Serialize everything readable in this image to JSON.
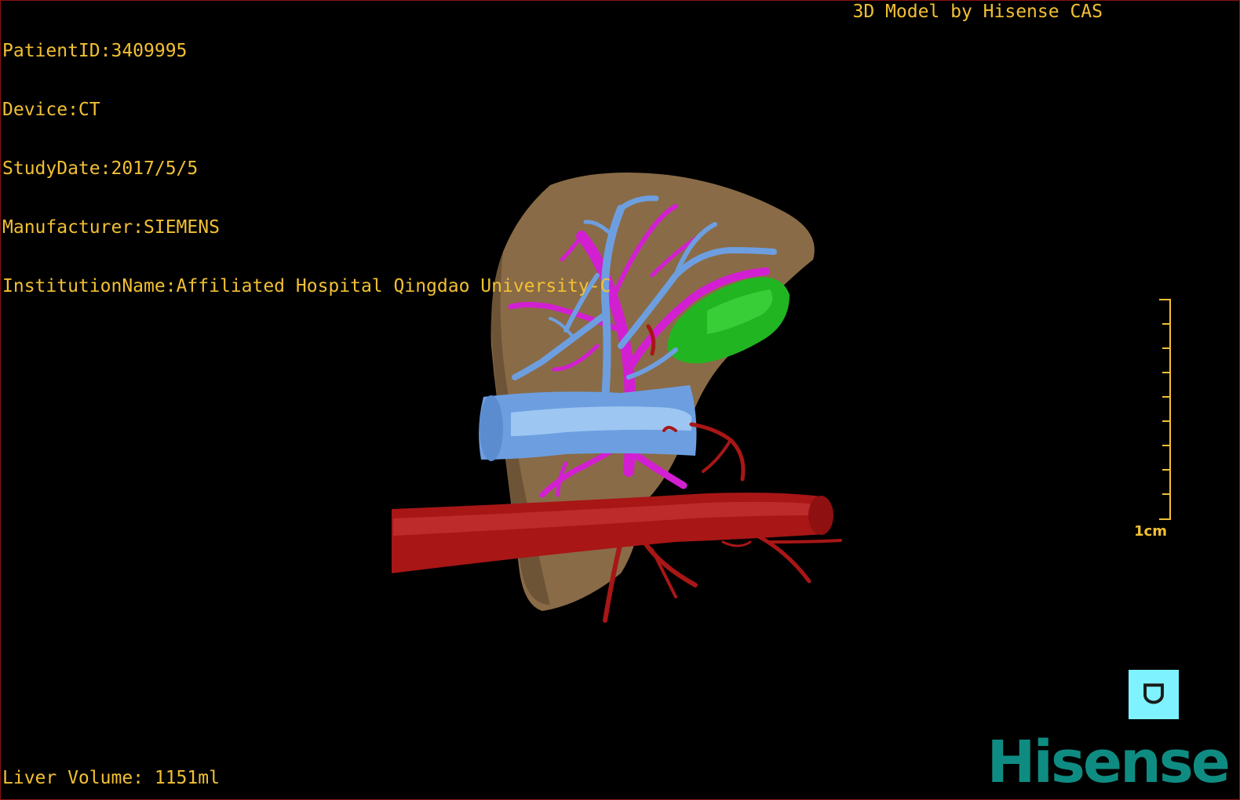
{
  "overlay": {
    "patient_id": "PatientID:3409995",
    "device": "Device:CT",
    "study_date": "StudyDate:2017/5/5",
    "manufacturer": "Manufacturer:SIEMENS",
    "institution": "InstitutionName:Affiliated Hospital Qingdao University-C",
    "credit": "3D Model by Hisense CAS",
    "liver_volume": "Liver Volume: 1151ml"
  },
  "scale_bar": {
    "label": "1cm"
  },
  "orientation_marker": {
    "glyph": "ᗜ",
    "color": "#7ff2ff"
  },
  "brand": {
    "logo_text": "Hisense",
    "color": "#0f8c82"
  },
  "colors": {
    "text": "#f2c033",
    "liver": "#8c6c46",
    "hepatic_vein": "#6d9fe0",
    "portal_vein": "#d21fd2",
    "artery": "#a81616",
    "tumor": "#22b522"
  }
}
